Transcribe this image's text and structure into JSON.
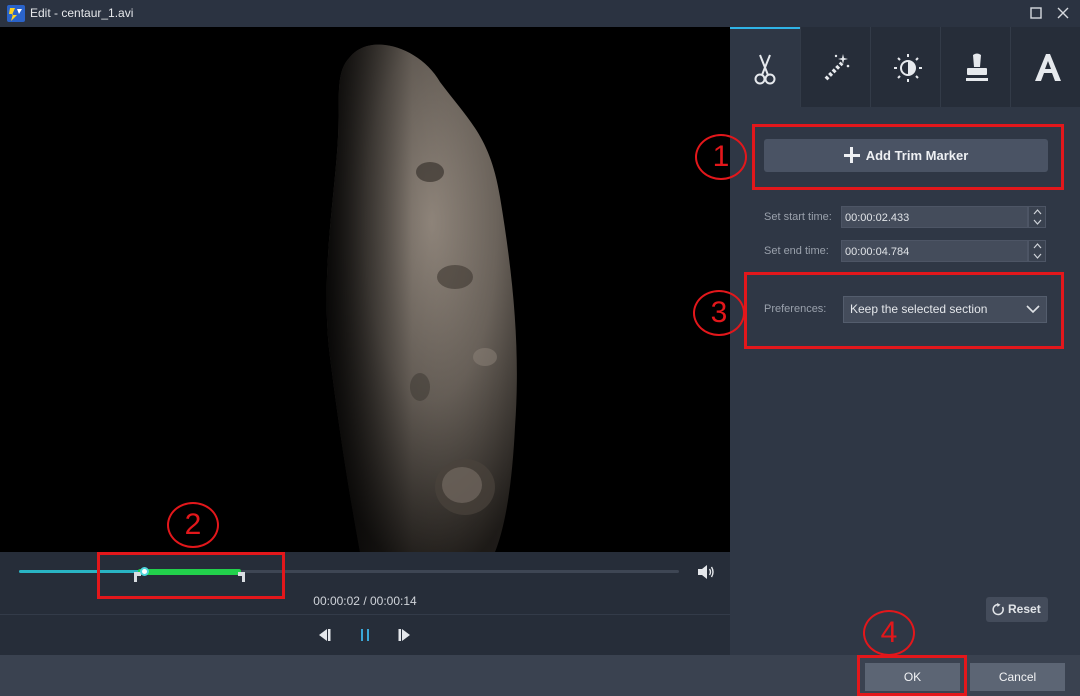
{
  "window": {
    "title": "Edit - centaur_1.avi"
  },
  "player": {
    "current_time": "00:00:02",
    "duration": "00:00:14",
    "time_separator": " / ",
    "progress_fraction": 0.19,
    "trim_start_fraction": 0.18,
    "trim_end_fraction": 0.336
  },
  "tabs": [
    {
      "name": "trim",
      "icon": "scissors-icon",
      "active": true
    },
    {
      "name": "effects",
      "icon": "magic-wand-icon",
      "active": false
    },
    {
      "name": "adjust",
      "icon": "brightness-icon",
      "active": false
    },
    {
      "name": "watermark",
      "icon": "stamp-icon",
      "active": false
    },
    {
      "name": "text",
      "icon": "text-icon",
      "active": false
    }
  ],
  "trim": {
    "add_marker_label": "Add Trim Marker",
    "start_label": "Set start time:",
    "start_value": "00:00:02.433",
    "end_label": "Set end time:",
    "end_value": "00:00:04.784",
    "preferences_label": "Preferences:",
    "preferences_value": "Keep the selected section",
    "reset_label": "Reset"
  },
  "footer": {
    "ok_label": "OK",
    "cancel_label": "Cancel"
  },
  "annotations": [
    "1",
    "2",
    "3",
    "4"
  ],
  "colors": {
    "trim_range": "#22d14c",
    "played": "#29b4c4",
    "annotation": "#e3171b",
    "active_tab_accent": "#2fb3e6"
  }
}
